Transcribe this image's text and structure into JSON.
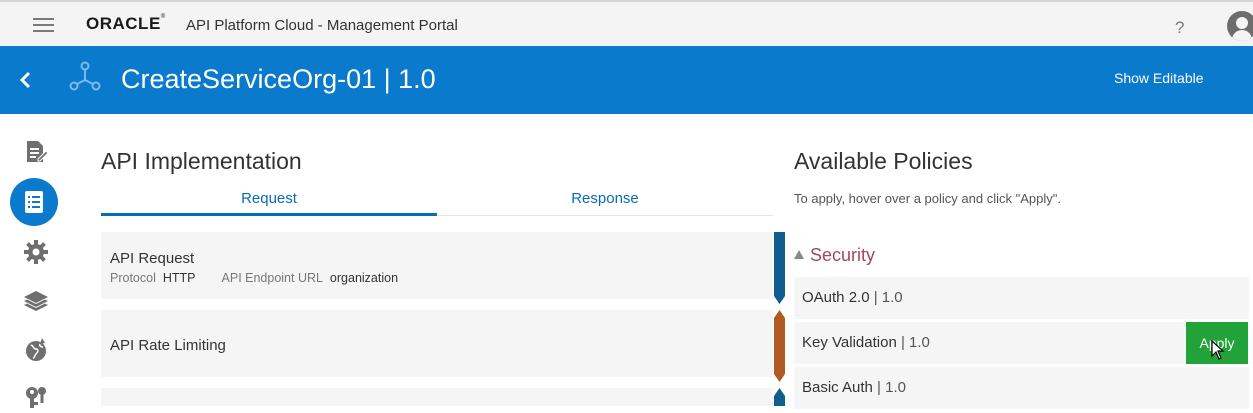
{
  "header": {
    "logo": "ORACLE",
    "app_title": "API Platform Cloud - Management Portal",
    "help_label": "?"
  },
  "banner": {
    "api_name": "CreateServiceOrg-01 | 1.0",
    "show_editable": "Show Editable"
  },
  "sidebar": {
    "items": [
      {
        "icon": "edit-document-icon"
      },
      {
        "icon": "implementation-icon",
        "active": true
      },
      {
        "icon": "gear-icon"
      },
      {
        "icon": "layers-icon"
      },
      {
        "icon": "globe-icon"
      },
      {
        "icon": "keys-icon"
      }
    ]
  },
  "implementation": {
    "title": "API Implementation",
    "tabs": [
      "Request",
      "Response"
    ],
    "selected_tab": "Request",
    "cards": [
      {
        "title": "API Request",
        "protocol_label": "Protocol",
        "protocol_value": "HTTP",
        "endpoint_label": "API Endpoint URL",
        "endpoint_value": "organization",
        "flag_color": "#0e5f8f"
      },
      {
        "title": "API Rate Limiting",
        "flag_color": "#b05a26"
      }
    ]
  },
  "policies": {
    "title": "Available Policies",
    "hint": "To apply, hover over a policy and click \"Apply\".",
    "section": "Security",
    "items": [
      {
        "name": "OAuth 2.0",
        "sep": " | ",
        "version": "1.0"
      },
      {
        "name": "Key Validation",
        "sep": " | ",
        "version": "1.0"
      },
      {
        "name": "Basic Auth",
        "sep": " | ",
        "version": "1.0"
      }
    ],
    "apply_label": "Apply"
  },
  "colors": {
    "brand_blue": "#0a7acc",
    "apply_green": "#21a33a",
    "security_heading": "#a3485a"
  }
}
